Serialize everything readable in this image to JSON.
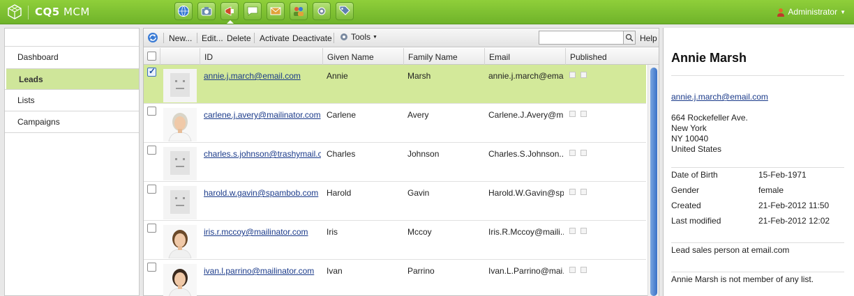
{
  "app": {
    "title_bold": "CQ5",
    "title_rest": " MCM",
    "logo_icon": "cube-logo-icon"
  },
  "launcher": [
    {
      "name": "websites-icon",
      "color": "#3a7bd5"
    },
    {
      "name": "digital-assets-icon",
      "color": "#6a8caf"
    },
    {
      "name": "campaigns-icon",
      "color": "#d04a2a",
      "active": true
    },
    {
      "name": "community-icon",
      "color": "#ffffff"
    },
    {
      "name": "inbox-icon",
      "color": "#e0a23a"
    },
    {
      "name": "users-icon",
      "color": "#5b8f2a"
    },
    {
      "name": "tools-icon",
      "color": "#7a8aa0"
    },
    {
      "name": "tagging-icon",
      "color": "#5f7fb0"
    }
  ],
  "user": {
    "label": "Administrator"
  },
  "nav": {
    "items": [
      {
        "label": "Dashboard"
      },
      {
        "label": "Leads",
        "active": true
      },
      {
        "label": "Lists"
      },
      {
        "label": "Campaigns"
      }
    ]
  },
  "toolbar": {
    "new_label": "New...",
    "edit_label": "Edit...",
    "delete_label": "Delete",
    "activate_label": "Activate",
    "deactivate_label": "Deactivate",
    "tools_label": "Tools",
    "help_label": "Help",
    "search_placeholder": ""
  },
  "grid": {
    "columns": [
      "ID",
      "Given Name",
      "Family Name",
      "Email",
      "Published"
    ],
    "rows": [
      {
        "id": "annie.j.march@email.com",
        "given": "Annie",
        "family": "Marsh",
        "email": "annie.j.march@ema...",
        "avatar": "placeholder",
        "selected": true
      },
      {
        "id": "carlene.j.avery@mailinator.com",
        "given": "Carlene",
        "family": "Avery",
        "email": "Carlene.J.Avery@m...",
        "avatar": "woman-older"
      },
      {
        "id": "charles.s.johnson@trashymail.c...",
        "given": "Charles",
        "family": "Johnson",
        "email": "Charles.S.Johnson...",
        "avatar": "placeholder"
      },
      {
        "id": "harold.w.gavin@spambob.com",
        "given": "Harold",
        "family": "Gavin",
        "email": "Harold.W.Gavin@sp...",
        "avatar": "placeholder"
      },
      {
        "id": "iris.r.mccoy@mailinator.com",
        "given": "Iris",
        "family": "Mccoy",
        "email": "Iris.R.Mccoy@maili...",
        "avatar": "woman-young"
      },
      {
        "id": "ivan.l.parrino@mailinator.com",
        "given": "Ivan",
        "family": "Parrino",
        "email": "Ivan.L.Parrino@mai...",
        "avatar": "man"
      }
    ]
  },
  "detail": {
    "name": "Annie Marsh",
    "email": "annie.j.march@email.com",
    "address": [
      "664 Rockefeller Ave.",
      "New York",
      "NY 10040",
      "United States"
    ],
    "fields": [
      {
        "label": "Date of Birth",
        "value": "15-Feb-1971"
      },
      {
        "label": "Gender",
        "value": "female"
      },
      {
        "label": "Created",
        "value": "21-Feb-2012 11:50"
      },
      {
        "label": "Last modified",
        "value": "21-Feb-2012 12:02"
      }
    ],
    "note": "Lead sales person at email.com",
    "lists_note": "Annie Marsh is not member of any list."
  },
  "colors": {
    "accent": "#7cbc36",
    "selected_row": "#d3e99a",
    "link": "#1a3a8a"
  }
}
